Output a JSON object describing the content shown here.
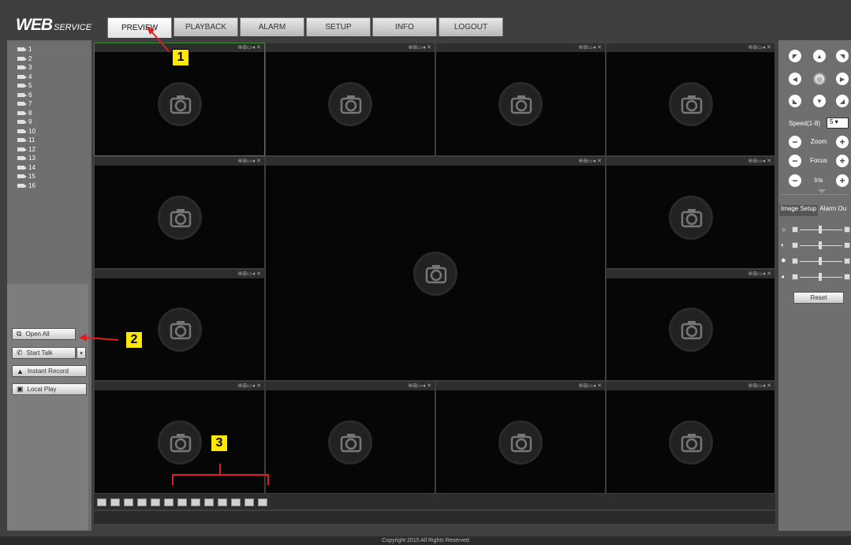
{
  "header": {
    "logo_big": "WEB",
    "logo_small": "SERVICE"
  },
  "tabs": [
    {
      "label": "PREVIEW",
      "active": true
    },
    {
      "label": "PLAYBACK",
      "active": false
    },
    {
      "label": "ALARM",
      "active": false
    },
    {
      "label": "SETUP",
      "active": false
    },
    {
      "label": "INFO",
      "active": false
    },
    {
      "label": "LOGOUT",
      "active": false
    }
  ],
  "channels": [
    "1",
    "2",
    "3",
    "4",
    "5",
    "6",
    "7",
    "8",
    "9",
    "10",
    "11",
    "12",
    "13",
    "14",
    "15",
    "16"
  ],
  "controls": {
    "open_all": "Open All",
    "start_talk": "Start Talk",
    "instant_record": "Instant Record",
    "local_play": "Local Play"
  },
  "ptz": {
    "speed_label": "Speed(1-8)",
    "speed_value": "5",
    "zoom": "Zoom",
    "focus": "Focus",
    "iris": "Iris"
  },
  "image": {
    "tab_setup": "Image Setup",
    "tab_alarm": "Alarm Ou",
    "reset": "Reset"
  },
  "callouts": {
    "c1": "1",
    "c2": "2",
    "c3": "3"
  },
  "footer": "Copyright 2015 All Rights Reserved",
  "video_tools": "⊕⊞▭◂ ✕",
  "colors": {
    "accent_red": "#e02020",
    "callout_yellow": "#ffe800",
    "selected_border": "#3a8a3a"
  }
}
